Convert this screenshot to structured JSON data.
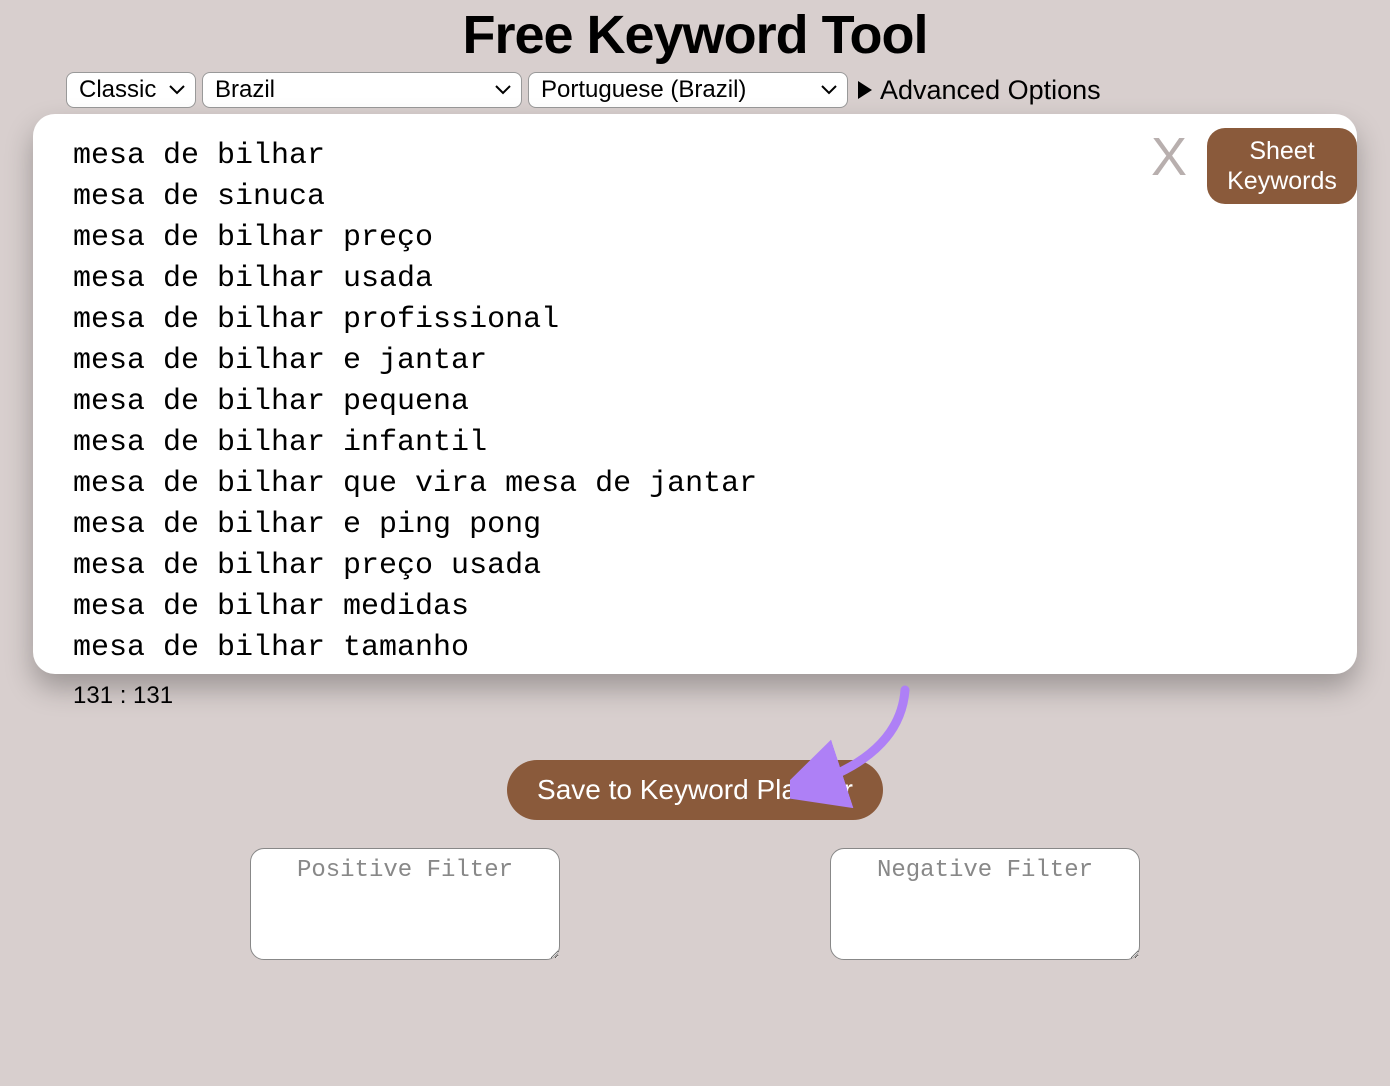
{
  "title": "Free Keyword Tool",
  "topbar": {
    "mode": "Classic",
    "country": "Brazil",
    "language": "Portuguese (Brazil)",
    "advanced_label": "Advanced Options"
  },
  "panel": {
    "close_label": "X",
    "sheet_button_line1": "Sheet",
    "sheet_button_line2": "Keywords",
    "keywords": [
      "mesa de bilhar",
      "mesa de sinuca",
      "mesa de bilhar preço",
      "mesa de bilhar usada",
      "mesa de bilhar profissional",
      "mesa de bilhar e jantar",
      "mesa de bilhar pequena",
      "mesa de bilhar infantil",
      "mesa de bilhar que vira mesa de jantar",
      "mesa de bilhar e ping pong",
      "mesa de bilhar preço usada",
      "mesa de bilhar medidas",
      "mesa de bilhar tamanho"
    ]
  },
  "counter_text": "131 : 131",
  "save_button_label": "Save to Keyword Planner",
  "filters": {
    "positive_placeholder": "Positive Filter",
    "negative_placeholder": "Negative Filter"
  },
  "colors": {
    "accent": "#8a5a3b",
    "arrow": "#ae80f6"
  }
}
